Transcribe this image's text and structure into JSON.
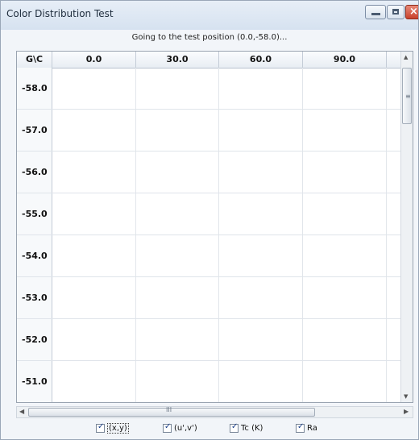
{
  "window": {
    "title": "Color Distribution Test"
  },
  "status_text": "Going to the test position (0.0,-58.0)...",
  "grid": {
    "corner_label": "G\\C",
    "columns": [
      "0.0",
      "30.0",
      "60.0",
      "90.0"
    ],
    "rows": [
      "-58.0",
      "-57.0",
      "-56.0",
      "-55.0",
      "-54.0",
      "-53.0",
      "-52.0",
      "-51.0"
    ]
  },
  "scrollbar": {
    "grip_glyph": "≡",
    "h_grip_glyph": "III"
  },
  "checkboxes": [
    {
      "label": "(x,y)",
      "checked": true
    },
    {
      "label": "(u',v')",
      "checked": true
    },
    {
      "label": "Tc (K)",
      "checked": true
    },
    {
      "label": "Ra",
      "checked": true
    }
  ]
}
